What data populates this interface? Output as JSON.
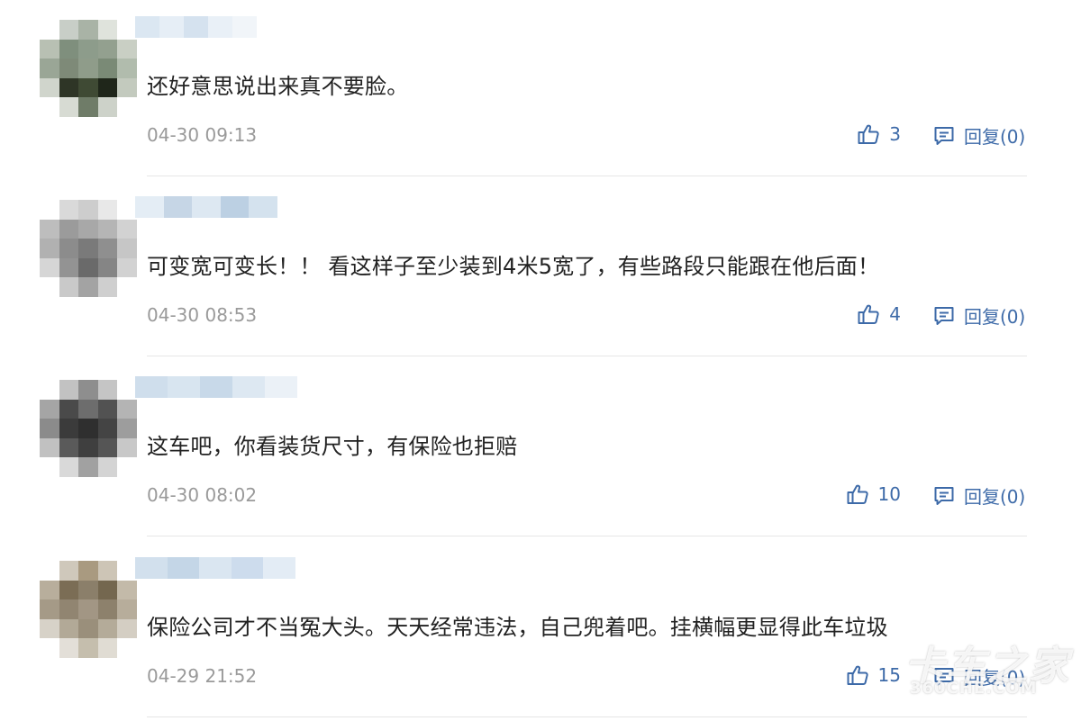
{
  "comments": [
    {
      "text": "还好意思说出来真不要脸。",
      "time": "04-30 09:13",
      "likes": "3",
      "reply_label": "回复(0)",
      "avatar_palette": [
        "#ffffff",
        "#c8cec7",
        "#a9b3a6",
        "#dfe3dc",
        "#ffffff",
        "#b8c0b3",
        "#7f8f7d",
        "#8d9c8b",
        "#93a08f",
        "#c9cfc4",
        "#9aa696",
        "#7e8a78",
        "#8f9c8a",
        "#7a8a76",
        "#b1bcad",
        "#d0d5cc",
        "#2e3526",
        "#3f4a34",
        "#1f261a",
        "#c3cabe",
        "#ffffff",
        "#d7dbd3",
        "#6f7c68",
        "#cdd2c9",
        "#ffffff"
      ],
      "username_palette": [
        "#dbe7f2",
        "#e6eef6",
        "#d5e2ef",
        "#e9f0f7",
        "#f1f5f9"
      ]
    },
    {
      "text": "可变宽可变长！！ 看这样子至少装到4米5宽了，有些路段只能跟在他后面！",
      "time": "04-30 08:53",
      "likes": "4",
      "reply_label": "回复(0)",
      "avatar_palette": [
        "#ffffff",
        "#d9d9d9",
        "#cdcdcd",
        "#e8e8e8",
        "#ffffff",
        "#bdbdbd",
        "#9b9b9b",
        "#a8a8a8",
        "#b5b5b5",
        "#d2d2d2",
        "#b1b1b1",
        "#8c8c8c",
        "#7a7a7a",
        "#8f8f8f",
        "#c6c6c6",
        "#d6d6d6",
        "#939393",
        "#6a6a6a",
        "#858585",
        "#d2d2d2",
        "#ffffff",
        "#c9c9c9",
        "#a3a3a3",
        "#cfcfcf",
        "#ffffff"
      ],
      "username_palette": [
        "#e4edf5",
        "#c6d6e6",
        "#dde8f2",
        "#bcd0e3",
        "#d4e2ee"
      ]
    },
    {
      "text": "这车吧，你看装货尺寸，有保险也拒赔",
      "time": "04-30 08:02",
      "likes": "10",
      "reply_label": "回复(0)",
      "avatar_palette": [
        "#ffffff",
        "#c2c2c2",
        "#8e8e8e",
        "#c5c5c5",
        "#ffffff",
        "#a5a5a5",
        "#4a4a4a",
        "#6d6d6d",
        "#525252",
        "#b4b4b4",
        "#8b8b8b",
        "#3b3b3b",
        "#2f2f2f",
        "#444444",
        "#9d9d9d",
        "#c1c1c1",
        "#5a5a5a",
        "#3f3f3f",
        "#555555",
        "#c8c8c8",
        "#ffffff",
        "#d9d9d9",
        "#a1a1a1",
        "#d4d4d4",
        "#ffffff"
      ],
      "username_palette": [
        "#cfdeec",
        "#d8e5f0",
        "#c8d9e9",
        "#dde8f2",
        "#ebf1f7"
      ]
    },
    {
      "text": "保险公司才不当冤大头。天天经常违法，自己兜着吧。挂横幅更显得此车垃圾",
      "time": "04-29 21:52",
      "likes": "15",
      "reply_label": "回复(0)",
      "avatar_palette": [
        "#ffffff",
        "#cfc8bb",
        "#a99a80",
        "#cdc5b6",
        "#ffffff",
        "#b8ae9c",
        "#7b6d55",
        "#8b7f6a",
        "#74674f",
        "#c3baa9",
        "#a59a87",
        "#918571",
        "#a29684",
        "#8d816c",
        "#b7ad9b",
        "#d7d2c8",
        "#b2a997",
        "#9a8f7b",
        "#b4ab99",
        "#d4cec3",
        "#ffffff",
        "#e3dfd8",
        "#c5bead",
        "#e0dcd3",
        "#ffffff"
      ],
      "username_palette": [
        "#d2e0ed",
        "#c4d6e7",
        "#dae6f1",
        "#cddced",
        "#e3ecf5"
      ]
    }
  ],
  "watermark": {
    "brand": "卡车之家",
    "site": "360CHE.COM"
  },
  "colors": {
    "accent": "#3d6aa8",
    "text": "#222222",
    "meta": "#9a9a9a",
    "divider": "#e6e6e6"
  }
}
